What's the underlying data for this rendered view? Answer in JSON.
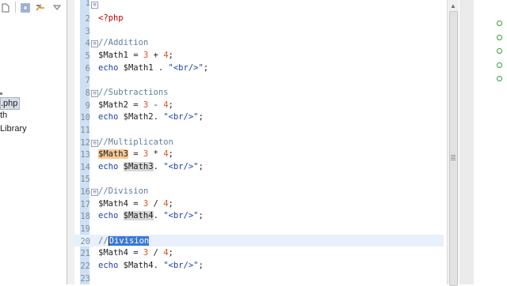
{
  "explorer": {
    "toolbar_icons": [
      "document-icon",
      "collapse-all-icon",
      "link-with-editor-icon",
      "view-menu-icon"
    ],
    "tree_items": [
      ".php",
      "th",
      "Library"
    ]
  },
  "editor": {
    "fold_top_label": "1",
    "lines": [
      {
        "n": "2",
        "tokens": [
          {
            "t": "<?php",
            "c": "tag"
          }
        ]
      },
      {
        "n": "3",
        "tokens": []
      },
      {
        "n": "4",
        "tokens": [
          {
            "t": "//Addition",
            "c": "cmt"
          }
        ]
      },
      {
        "n": "5",
        "tokens": [
          {
            "t": "$Math1",
            "c": "var"
          },
          {
            "t": " = ",
            "c": "op"
          },
          {
            "t": "3",
            "c": "num"
          },
          {
            "t": " + ",
            "c": "op"
          },
          {
            "t": "4",
            "c": "num"
          },
          {
            "t": ";",
            "c": "semi"
          }
        ]
      },
      {
        "n": "6",
        "tokens": [
          {
            "t": "echo",
            "c": "kw"
          },
          {
            "t": " ",
            "c": "op"
          },
          {
            "t": "$Math1",
            "c": "var"
          },
          {
            "t": " . ",
            "c": "op"
          },
          {
            "t": "\"<br/>\"",
            "c": "str"
          },
          {
            "t": ";",
            "c": "semi"
          }
        ]
      },
      {
        "n": "7",
        "tokens": []
      },
      {
        "n": "8",
        "tokens": [
          {
            "t": "//Subtractions",
            "c": "cmt"
          }
        ]
      },
      {
        "n": "9",
        "tokens": [
          {
            "t": "$Math2",
            "c": "var"
          },
          {
            "t": " = ",
            "c": "op"
          },
          {
            "t": "3",
            "c": "num"
          },
          {
            "t": " - ",
            "c": "op"
          },
          {
            "t": "4",
            "c": "num"
          },
          {
            "t": ";",
            "c": "semi"
          }
        ]
      },
      {
        "n": "10",
        "tokens": [
          {
            "t": "echo",
            "c": "kw"
          },
          {
            "t": " ",
            "c": "op"
          },
          {
            "t": "$Math2",
            "c": "var"
          },
          {
            "t": ". ",
            "c": "op"
          },
          {
            "t": "\"<br/>\"",
            "c": "str"
          },
          {
            "t": ";",
            "c": "semi"
          }
        ]
      },
      {
        "n": "11",
        "tokens": []
      },
      {
        "n": "12",
        "tokens": [
          {
            "t": "//Multiplicaton",
            "c": "cmt"
          }
        ]
      },
      {
        "n": "13",
        "tokens": [
          {
            "t": "$Math3",
            "c": "var",
            "h": "var"
          },
          {
            "t": " = ",
            "c": "op"
          },
          {
            "t": "3",
            "c": "num"
          },
          {
            "t": " * ",
            "c": "op"
          },
          {
            "t": "4",
            "c": "num"
          },
          {
            "t": ";",
            "c": "semi"
          }
        ]
      },
      {
        "n": "14",
        "tokens": [
          {
            "t": "echo",
            "c": "kw"
          },
          {
            "t": " ",
            "c": "op"
          },
          {
            "t": "$Math3",
            "c": "var",
            "h": "occ"
          },
          {
            "t": ". ",
            "c": "op"
          },
          {
            "t": "\"<br/>\"",
            "c": "str"
          },
          {
            "t": ";",
            "c": "semi"
          }
        ]
      },
      {
        "n": "15",
        "tokens": []
      },
      {
        "n": "16",
        "tokens": [
          {
            "t": "//Division",
            "c": "cmt"
          }
        ]
      },
      {
        "n": "17",
        "tokens": [
          {
            "t": "$Math4",
            "c": "var"
          },
          {
            "t": " = ",
            "c": "op"
          },
          {
            "t": "3",
            "c": "num"
          },
          {
            "t": " / ",
            "c": "op"
          },
          {
            "t": "4",
            "c": "num"
          },
          {
            "t": ";",
            "c": "semi"
          }
        ]
      },
      {
        "n": "18",
        "tokens": [
          {
            "t": "echo",
            "c": "kw"
          },
          {
            "t": " ",
            "c": "op"
          },
          {
            "t": "$Math4",
            "c": "var",
            "h": "occ"
          },
          {
            "t": ". ",
            "c": "op"
          },
          {
            "t": "\"<br/>\"",
            "c": "str"
          },
          {
            "t": ";",
            "c": "semi"
          }
        ]
      },
      {
        "n": "19",
        "tokens": []
      },
      {
        "n": "20",
        "tokens": [
          {
            "t": "//",
            "c": "cmt"
          },
          {
            "t": "",
            "c": "caret"
          },
          {
            "t": "Division",
            "c": "cmt",
            "h": "sel"
          }
        ]
      },
      {
        "n": "21",
        "tokens": [
          {
            "t": "$Math4",
            "c": "var"
          },
          {
            "t": " = ",
            "c": "op"
          },
          {
            "t": "3",
            "c": "num"
          },
          {
            "t": " / ",
            "c": "op"
          },
          {
            "t": "4",
            "c": "num"
          },
          {
            "t": ";",
            "c": "semi"
          }
        ]
      },
      {
        "n": "22",
        "tokens": [
          {
            "t": "echo",
            "c": "kw"
          },
          {
            "t": " ",
            "c": "op"
          },
          {
            "t": "$Math4",
            "c": "var"
          },
          {
            "t": ". ",
            "c": "op"
          },
          {
            "t": "\"<br/>\"",
            "c": "str"
          },
          {
            "t": ";",
            "c": "semi"
          }
        ]
      },
      {
        "n": "23",
        "tokens": []
      }
    ],
    "fold_marker_lines": [
      "4",
      "8",
      "12",
      "16"
    ]
  },
  "outline": {
    "markers": [
      "o",
      "o",
      "o",
      "o",
      "o"
    ]
  },
  "colors": {
    "gutter": "#cfe0f4",
    "selection": "#3a78d8",
    "occurrence": "#d8d8d8",
    "var_highlight": "#fbc994",
    "string": "#1a3fa8",
    "number": "#e05020",
    "comment": "#5f7f9f",
    "php_tag": "#c00000"
  }
}
